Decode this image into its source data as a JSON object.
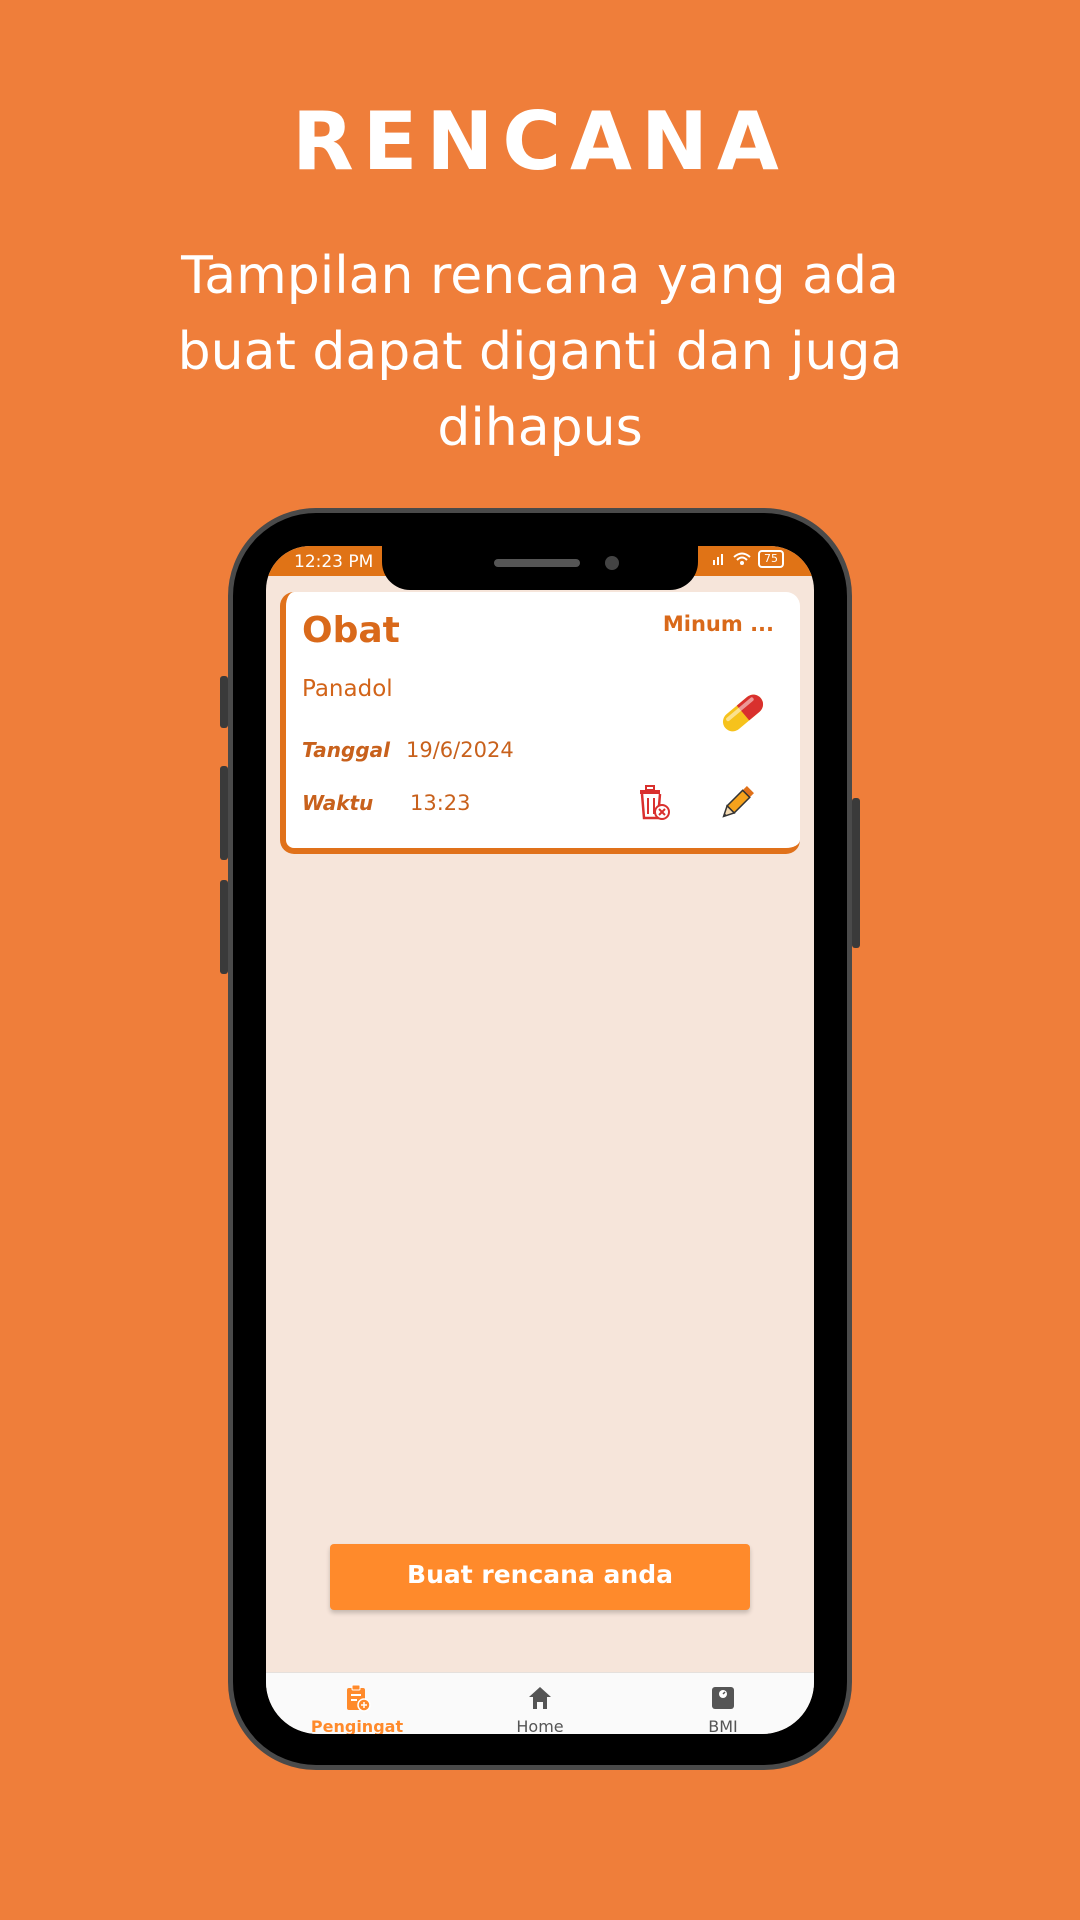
{
  "promo": {
    "headline": "RENCANA",
    "subtitle": "Tampilan rencana yang ada buat dapat diganti dan juga dihapus"
  },
  "status_bar": {
    "time": "12:23 PM",
    "battery": "75"
  },
  "plan_card": {
    "title": "Obat",
    "type": "Minum ...",
    "name": "Panadol",
    "date_label": "Tanggal",
    "date_value": "19/6/2024",
    "time_label": "Waktu",
    "time_value": "13:23",
    "icon": "pill-icon"
  },
  "actions": {
    "delete_icon": "trash-icon",
    "edit_icon": "pencil-icon"
  },
  "cta": {
    "label": "Buat rencana anda"
  },
  "bottom_nav": {
    "items": [
      {
        "label": "Pengingat",
        "icon": "clipboard-add-icon",
        "active": true
      },
      {
        "label": "Home",
        "icon": "home-icon",
        "active": false
      },
      {
        "label": "BMI",
        "icon": "scale-icon",
        "active": false
      }
    ]
  },
  "colors": {
    "background": "#EF7E3A",
    "accent": "#FF8A2B",
    "card_border": "#E0711A",
    "screen_bg": "#F6E5DA"
  }
}
